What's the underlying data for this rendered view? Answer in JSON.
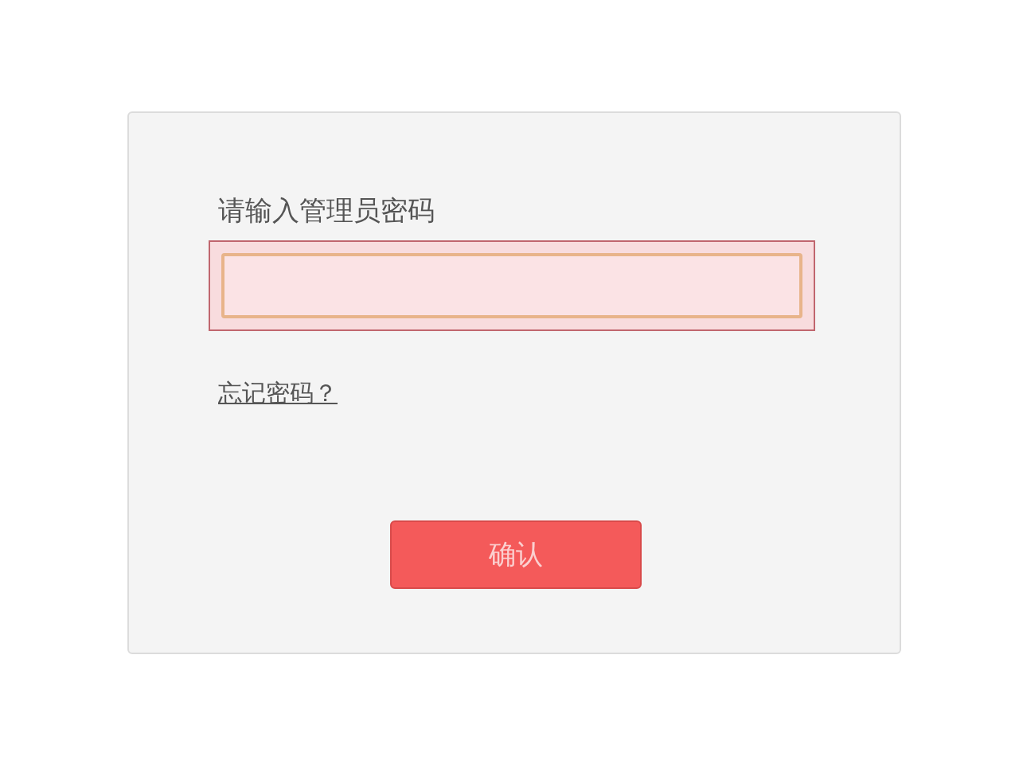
{
  "login": {
    "label": "请输入管理员密码",
    "password": {
      "error": true
    },
    "forgot_link": "忘记密码？",
    "submit_button": "确认"
  }
}
